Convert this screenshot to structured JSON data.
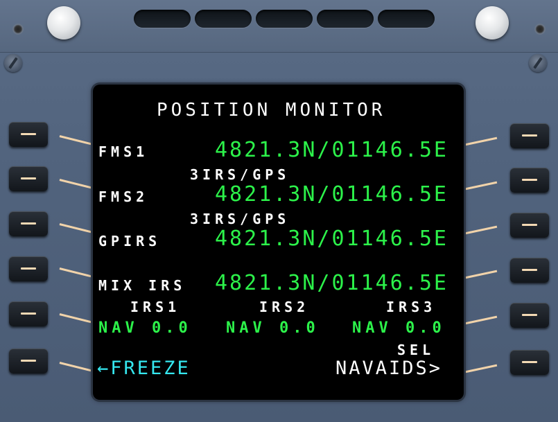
{
  "screen": {
    "title": "POSITION MONITOR",
    "rows": {
      "fms1_label": "FMS1",
      "fms1_pos": "4821.3N/01146.5E",
      "fms1_source": "3IRS/GPS",
      "fms2_label": "FMS2",
      "fms2_pos": "4821.3N/01146.5E",
      "fms2_source": "3IRS/GPS",
      "gpirs_label": "GPIRS",
      "gpirs_pos": "4821.3N/01146.5E",
      "mixirs_label": "MIX IRS",
      "mixirs_pos": "4821.3N/01146.5E"
    },
    "irs": [
      {
        "label": "IRS1",
        "status": "NAV 0.0"
      },
      {
        "label": "IRS2",
        "status": "NAV 0.0"
      },
      {
        "label": "IRS3",
        "status": "NAV 0.0"
      }
    ],
    "bottom": {
      "freeze": "←FREEZE",
      "sel_label": "SEL",
      "navaids": "NAVAIDS>"
    }
  },
  "colors": {
    "data_green": "#2cf24a",
    "prompt_cyan": "#35e7ef",
    "label_white": "#ffffff",
    "bezel_blue": "#53657f"
  },
  "icons": [
    "brightness-knob",
    "screw",
    "line-select-key"
  ]
}
